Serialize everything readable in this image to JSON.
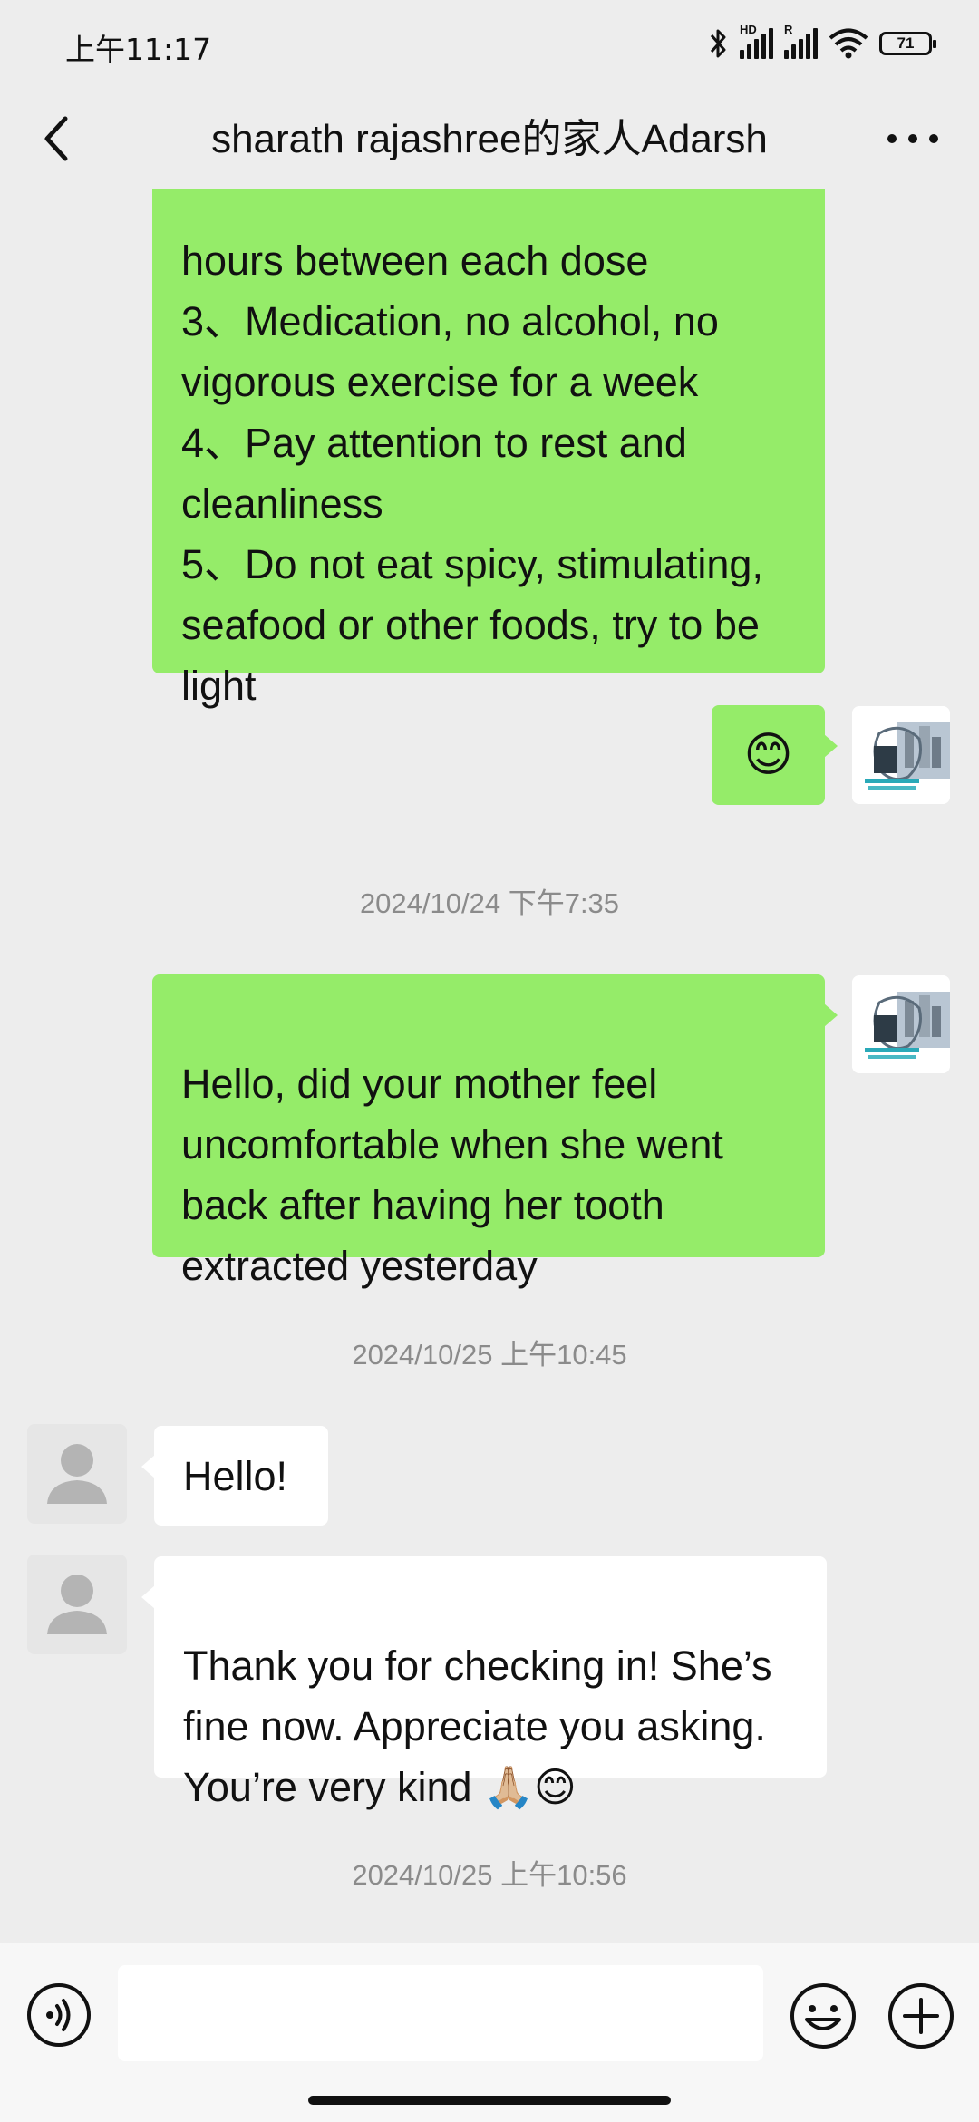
{
  "status_bar": {
    "time": "上午11:17",
    "sim1_tag": "HD",
    "sim2_tag": "R",
    "battery": "71",
    "icons": [
      "bluetooth-icon",
      "signal-icon",
      "signal-icon",
      "wifi-icon",
      "battery-icon"
    ]
  },
  "header": {
    "back_icon": "chevron-left-icon",
    "title": "sharath rajashree的家人Adarsh",
    "more_icon": "more-dots-icon"
  },
  "messages": [
    {
      "sender": "me",
      "text": "hours between each dose\n3、Medication, no alcohol, no vigorous exercise for a week\n4、Pay attention to rest and cleanliness\n5、Do not eat spicy, stimulating, seafood or other foods, try to be light"
    },
    {
      "sender": "me",
      "text": "😊"
    },
    {
      "timestamp": "2024/10/24 下午7:35"
    },
    {
      "sender": "me",
      "text": "Hello, did your mother feel uncomfortable when she went back after having her tooth extracted yesterday"
    },
    {
      "timestamp": "2024/10/25 上午10:45"
    },
    {
      "sender": "them",
      "text": "Hello!"
    },
    {
      "sender": "them",
      "text": "Thank you for checking in! She’s fine now. Appreciate you asking. You’re very kind 🙏🏼😊"
    },
    {
      "timestamp": "2024/10/25 上午10:56"
    }
  ],
  "input_bar": {
    "voice_icon": "voice-icon",
    "input_value": "",
    "emoji_icon": "emoji-icon",
    "plus_icon": "plus-icon"
  },
  "colors": {
    "my_bubble": "#95ec69",
    "their_bubble": "#ffffff",
    "background": "#ededed"
  }
}
